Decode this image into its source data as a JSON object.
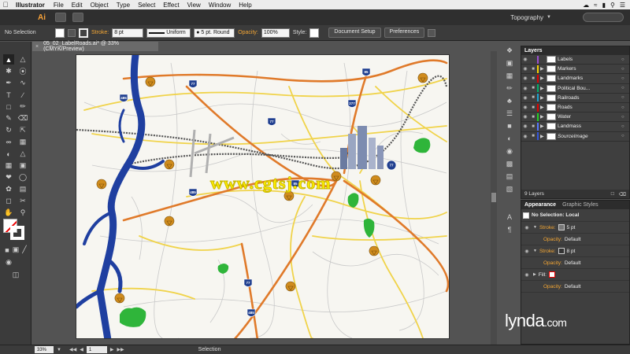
{
  "menubar": {
    "app": "Illustrator",
    "items": [
      "File",
      "Edit",
      "Object",
      "Type",
      "Select",
      "Effect",
      "View",
      "Window",
      "Help"
    ]
  },
  "appbar": {
    "logo": "Ai",
    "workspace": "Topography"
  },
  "control": {
    "selection": "No Selection",
    "stroke_label": "Stroke:",
    "stroke_value": "8 pt",
    "profile": "Uniform",
    "brush": "5 pt. Round",
    "opacity_label": "Opacity:",
    "opacity_value": "100%",
    "style_label": "Style:",
    "doc_setup": "Document Setup",
    "preferences": "Preferences"
  },
  "document": {
    "tab_title": "05_02_LabelRoads.ai* @ 33% (CMYK/Preview)",
    "close": "×"
  },
  "map": {
    "watermark": "www.cgtsj.com",
    "shields": [
      "485",
      "77",
      "85",
      "277",
      "77",
      "485",
      "85",
      "77",
      "485",
      "77"
    ],
    "colors": {
      "river": "#1f3fa0",
      "highway": "#e07a2a",
      "road": "#f0d34a",
      "rail": "#555555",
      "park": "#2fb53a",
      "marker": "#d08c1d",
      "interstate": "#203f8f"
    }
  },
  "layers": {
    "tab": "Layers",
    "count_label": "9 Layers",
    "items": [
      {
        "name": "Labels",
        "color": "#9b4fd1"
      },
      {
        "name": "Markers",
        "color": "#f3d000"
      },
      {
        "name": "Landmarks",
        "color": "#e00000"
      },
      {
        "name": "Political Bou...",
        "color": "#00b06a"
      },
      {
        "name": "Railroads",
        "color": "#1aa1d0"
      },
      {
        "name": "Roads",
        "color": "#e00000"
      },
      {
        "name": "Water",
        "color": "#22d022"
      },
      {
        "name": "Landmass",
        "color": "#5577ff"
      },
      {
        "name": "SourceImage",
        "color": "#3355dd"
      }
    ]
  },
  "appearance": {
    "tabs": [
      "Appearance",
      "Graphic Styles"
    ],
    "title": "No Selection: Local",
    "rows": [
      {
        "label": "Stroke:",
        "value": "5 pt",
        "kind": "stroke"
      },
      {
        "label": "Opacity:",
        "value": "Default",
        "kind": "opacity"
      },
      {
        "label": "Stroke:",
        "value": "8 pt",
        "kind": "stroke"
      },
      {
        "label": "Opacity:",
        "value": "Default",
        "kind": "opacity"
      },
      {
        "label": "Fill:",
        "value": "",
        "kind": "fill"
      },
      {
        "label": "Opacity:",
        "value": "Default",
        "kind": "opacity"
      }
    ]
  },
  "status": {
    "zoom": "33%",
    "page": "1",
    "tool": "Selection"
  },
  "brand": {
    "name": "lynda",
    "suffix": ".com"
  }
}
